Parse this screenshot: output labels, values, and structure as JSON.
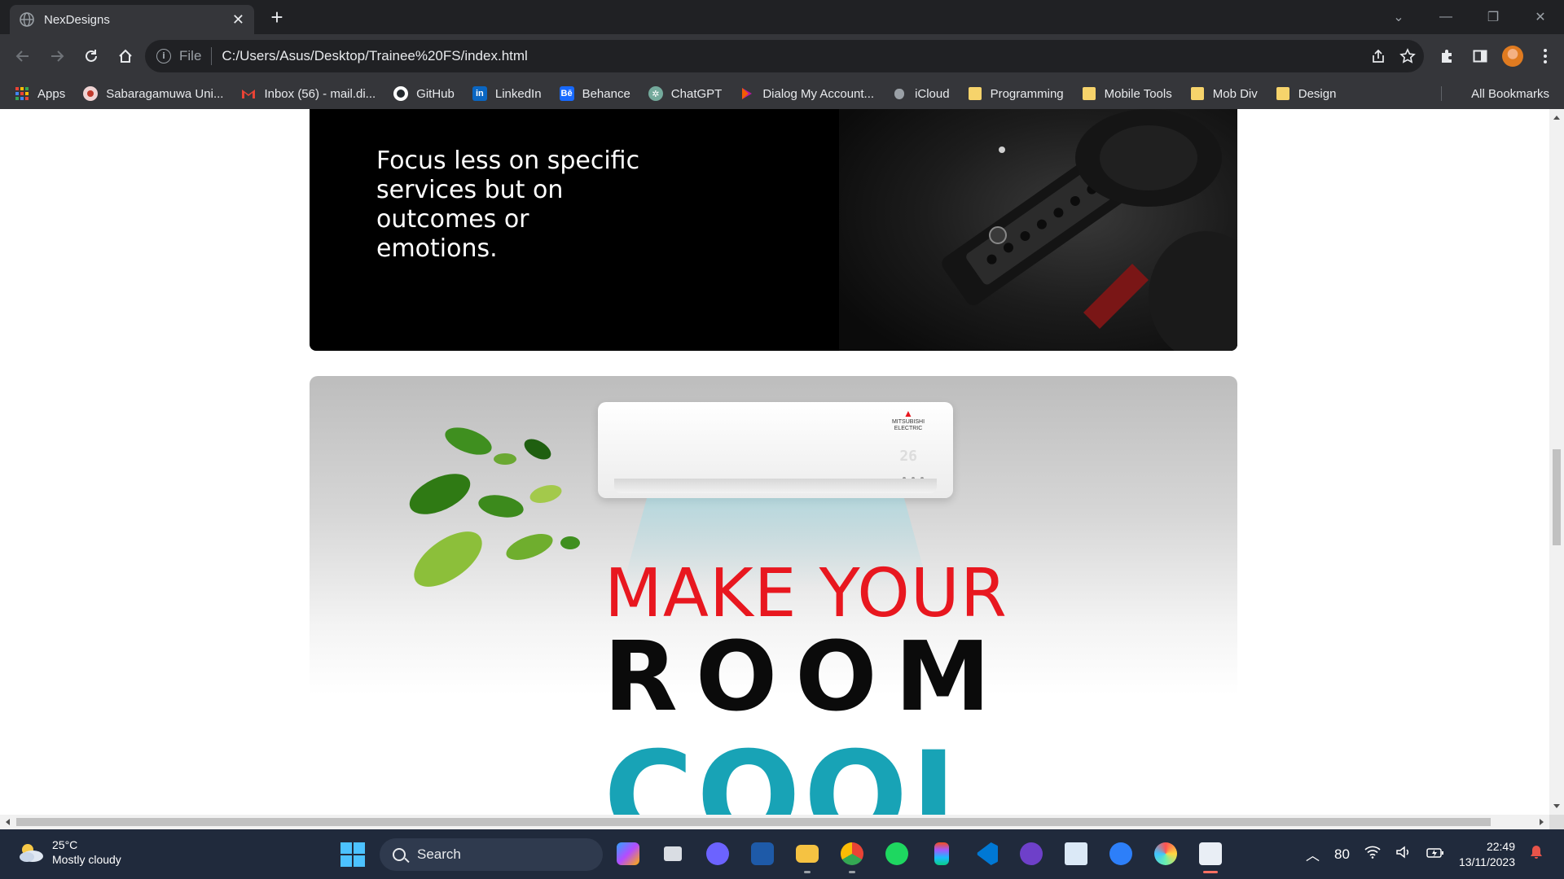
{
  "browser": {
    "tab_title": "NexDesigns",
    "url_scheme": "File",
    "url": "C:/Users/Asus/Desktop/Trainee%20FS/index.html"
  },
  "bookmarks": [
    {
      "label": "Apps",
      "icon": "apps-grid-icon",
      "color": "#ea4335"
    },
    {
      "label": "Sabaragamuwa Uni...",
      "icon": "university-icon",
      "color": "#d9534f"
    },
    {
      "label": "Inbox (56) - mail.di...",
      "icon": "gmail-icon",
      "color": "#ea4335"
    },
    {
      "label": "GitHub",
      "icon": "github-icon",
      "color": "#ffffff"
    },
    {
      "label": "LinkedIn",
      "icon": "linkedin-icon",
      "color": "#0a66c2"
    },
    {
      "label": "Behance",
      "icon": "behance-icon",
      "color": "#1769ff"
    },
    {
      "label": "ChatGPT",
      "icon": "chatgpt-icon",
      "color": "#74aa9c"
    },
    {
      "label": "Dialog My Account...",
      "icon": "dialog-icon",
      "color": "#b5179e"
    },
    {
      "label": "iCloud",
      "icon": "apple-icon",
      "color": "#9aa0a6"
    },
    {
      "label": "Programming",
      "icon": "folder-icon",
      "color": "#f6d36b"
    },
    {
      "label": "Mobile Tools",
      "icon": "folder-icon",
      "color": "#f6d36b"
    },
    {
      "label": "Mob Div",
      "icon": "folder-icon",
      "color": "#f6d36b"
    },
    {
      "label": "Design",
      "icon": "folder-icon",
      "color": "#f6d36b"
    }
  ],
  "all_bookmarks_label": "All Bookmarks",
  "page": {
    "dark_card_text": "Focus less on specific services but on outcomes or emotions.",
    "ac_line1": "MAKE YOUR",
    "ac_line2": "ROOM",
    "ac_line3": "COOL",
    "ac_display": "26",
    "ac_brand": "MITSUBISHI ELECTRIC"
  },
  "taskbar": {
    "temperature": "25°C",
    "weather": "Mostly cloudy",
    "search_label": "Search",
    "tray_number": "80",
    "time": "22:49",
    "date": "13/11/2023"
  }
}
